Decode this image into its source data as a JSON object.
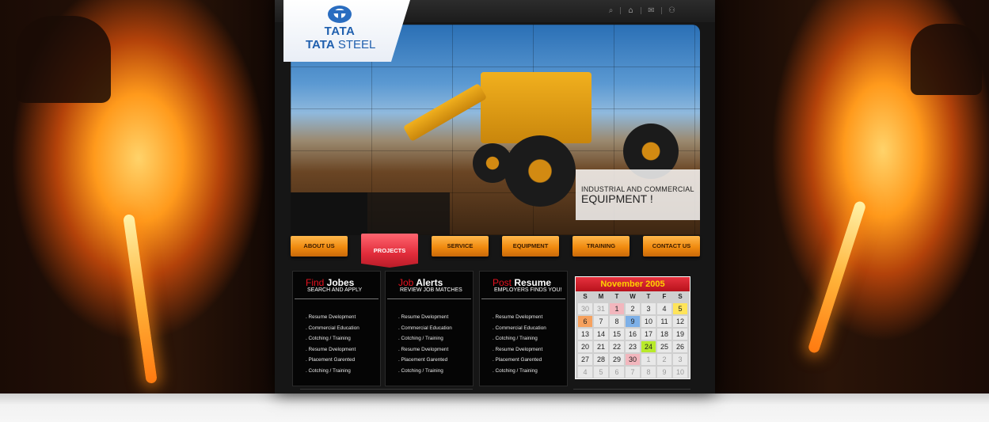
{
  "brand": {
    "mark": "TATA",
    "name_bold": "TATA",
    "name_rest": " STEEL"
  },
  "topbar": {
    "icons": [
      "search-icon",
      "home-icon",
      "mail-icon",
      "sitemap-icon"
    ],
    "icon_glyphs": [
      "⌕",
      "⌂",
      "✉",
      "⚇"
    ]
  },
  "hero": {
    "caption_small": "INDUSTRIAL AND COMMERCIAL",
    "caption_large": "EQUIPMENT !"
  },
  "nav": [
    {
      "label": "ABOUT US",
      "active": false
    },
    {
      "label": "PROJECTS",
      "active": true
    },
    {
      "label": "SERVICE",
      "active": false
    },
    {
      "label": "EQUIPMENT",
      "active": false
    },
    {
      "label": "TRAINING",
      "active": false
    },
    {
      "label": "CONTACT US",
      "active": false
    }
  ],
  "columns": [
    {
      "title_red": "Find",
      "title_white": " Jobes",
      "subtitle": "SEARCH AND APPLY",
      "items": [
        ". Resume Dvelopment",
        ". Commercial Education",
        ". Cotching / Training",
        ". Resume Dvelopment",
        ". Placement Garented",
        ". Cotching / Training"
      ]
    },
    {
      "title_red": "Job",
      "title_white": " Alerts",
      "subtitle": "REVIEW JOB MATCHES",
      "items": [
        ". Resume Dvelopment",
        ". Commercial Education",
        ". Cotching / Training",
        ". Resume Dvelopment",
        ". Placement Garented",
        ". Cotching / Training"
      ]
    },
    {
      "title_red": "Post",
      "title_white": " Resume",
      "subtitle": "EMPLOYERS FINDS YOU!",
      "items": [
        ". Resume Dvelopment",
        ". Commercial Education",
        ". Cotching / Training",
        ". Resume Dvelopment",
        ". Placement Garented",
        ". Cotching / Training"
      ]
    }
  ],
  "calendar": {
    "title": "November 2005",
    "weekdays": [
      "S",
      "M",
      "T",
      "W",
      "T",
      "F",
      "S"
    ],
    "weeks": [
      [
        {
          "d": "30",
          "s": "muted"
        },
        {
          "d": "31",
          "s": "muted"
        },
        {
          "d": "1",
          "s": "pink"
        },
        {
          "d": "2"
        },
        {
          "d": "3"
        },
        {
          "d": "4"
        },
        {
          "d": "5",
          "s": "yellow"
        }
      ],
      [
        {
          "d": "6",
          "s": "orange"
        },
        {
          "d": "7"
        },
        {
          "d": "8"
        },
        {
          "d": "9",
          "s": "blue"
        },
        {
          "d": "10"
        },
        {
          "d": "11"
        },
        {
          "d": "12"
        }
      ],
      [
        {
          "d": "13"
        },
        {
          "d": "14"
        },
        {
          "d": "15"
        },
        {
          "d": "16"
        },
        {
          "d": "17"
        },
        {
          "d": "18"
        },
        {
          "d": "19"
        }
      ],
      [
        {
          "d": "20"
        },
        {
          "d": "21"
        },
        {
          "d": "22"
        },
        {
          "d": "23"
        },
        {
          "d": "24",
          "s": "green"
        },
        {
          "d": "25"
        },
        {
          "d": "26"
        }
      ],
      [
        {
          "d": "27"
        },
        {
          "d": "28"
        },
        {
          "d": "29"
        },
        {
          "d": "30",
          "s": "pink"
        },
        {
          "d": "1",
          "s": "muted"
        },
        {
          "d": "2",
          "s": "muted"
        },
        {
          "d": "3",
          "s": "muted"
        }
      ],
      [
        {
          "d": "4",
          "s": "muted"
        },
        {
          "d": "5",
          "s": "muted"
        },
        {
          "d": "6",
          "s": "muted"
        },
        {
          "d": "7",
          "s": "muted"
        },
        {
          "d": "8",
          "s": "muted"
        },
        {
          "d": "9",
          "s": "muted"
        },
        {
          "d": "10",
          "s": "muted"
        }
      ]
    ],
    "highlight_colors": {
      "pink": "#f2b6bd",
      "yellow": "#ffe45a",
      "orange": "#f6a15e",
      "blue": "#7db0e8",
      "green": "#b8ea2a"
    }
  },
  "colors": {
    "accent_red": "#e6121f",
    "nav_orange": "#f08a0f",
    "brand_blue": "#1f5fae"
  }
}
